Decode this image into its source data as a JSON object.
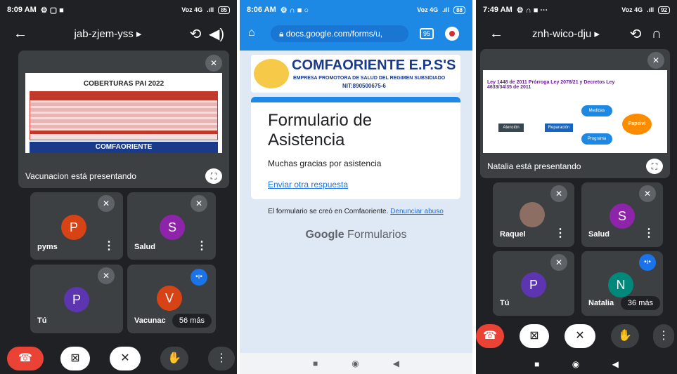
{
  "left": {
    "status": {
      "time": "8:09 AM",
      "icons": "⚙ ▢ ■",
      "network": "Voz 4G",
      "signal": ".ıll",
      "battery": "85"
    },
    "meeting_code": "jab-zjem-yss",
    "presentation": {
      "slide_title": "COBERTURAS PAI 2022",
      "logo_text": "COMFAORIENTE",
      "presenter_label": "Vacunacion está presentando"
    },
    "tiles": [
      {
        "initial": "P",
        "name": "pyms",
        "color": "#d84315"
      },
      {
        "initial": "S",
        "name": "Salud",
        "color": "#8e24aa"
      },
      {
        "initial": "P",
        "name": "Tú",
        "color": "#5e35b1"
      },
      {
        "initial": "V",
        "name": "Vacunac",
        "color": "#d84315"
      }
    ],
    "more_label": "56 más"
  },
  "middle": {
    "status": {
      "time": "8:06 AM",
      "icons": "⚙ ∩ ■ ○",
      "network": "Voz 4G",
      "signal": ".ıll",
      "battery": "88"
    },
    "url": "docs.google.com/forms/u,",
    "tab_count": "95",
    "banner_title": "COMFAORIENTE E.P.S'S",
    "banner_subtitle": "EMPRESA PROMOTORA DE SALUD DEL REGIMEN SUBSIDIADO",
    "banner_nit": "NIT:890500675-6",
    "form_title": "Formulario de Asistencia",
    "thanks": "Muchas gracias por asistencia",
    "another_link": "Enviar otra respuesta",
    "footer_text": "El formulario se creó en Comfaoriente.",
    "abuse_link": "Denunciar abuso",
    "google": "Google",
    "forms": "Formularios"
  },
  "right": {
    "status": {
      "time": "7:49 AM",
      "icons": "⚙ ∩ ■ ···",
      "network": "Voz 4G",
      "signal": ".ıll",
      "battery": "92"
    },
    "meeting_code": "znh-wico-dju",
    "presentation": {
      "slide_title": "Ley 1448 de 2011 Prórroga Ley 2078/21 y Decretos Ley 4633/34/35 de 2011",
      "flow_left": "Atención",
      "flow_center": "Reparación",
      "flow_top": "Medidas Rehabilitación",
      "flow_bottom": "Programa Rehabilitación",
      "flow_right": "Papsivi",
      "presenter_label": "Natalia está presentando"
    },
    "tiles": [
      {
        "initial": "",
        "name": "Raquel",
        "color": "#8d6e63"
      },
      {
        "initial": "S",
        "name": "Salud",
        "color": "#8e24aa"
      },
      {
        "initial": "P",
        "name": "Tú",
        "color": "#5e35b1"
      },
      {
        "initial": "N",
        "name": "Natalia",
        "color": "#00897b"
      }
    ],
    "more_label": "36 más"
  }
}
